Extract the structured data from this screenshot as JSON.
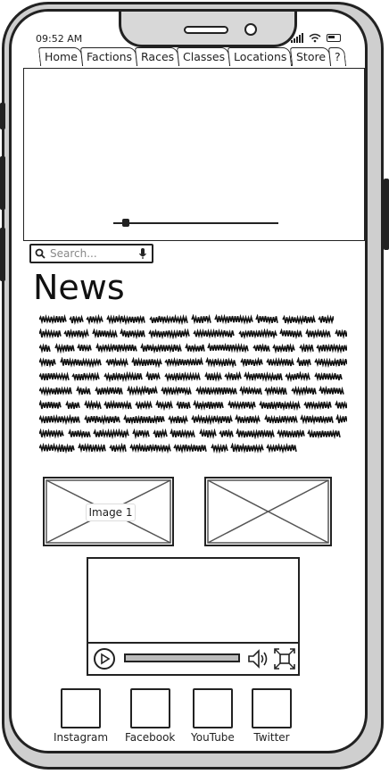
{
  "status_bar": {
    "time": "09:52 AM"
  },
  "tabs": [
    {
      "label": "Home"
    },
    {
      "label": "Factions"
    },
    {
      "label": "Races"
    },
    {
      "label": "Classes"
    },
    {
      "label": "Locations"
    },
    {
      "label": "Store"
    },
    {
      "label": "?"
    }
  ],
  "hero": {
    "slider_value": 0.08
  },
  "search": {
    "placeholder": "Search..."
  },
  "news": {
    "title": "News"
  },
  "images": [
    {
      "label": "Image 1"
    },
    {
      "label": ""
    }
  ],
  "video": {
    "progress": 1.0
  },
  "social": [
    {
      "label": "Instagram"
    },
    {
      "label": "Facebook"
    },
    {
      "label": "YouTube"
    },
    {
      "label": "Twitter"
    }
  ],
  "icons": [
    "search-icon",
    "mic-icon",
    "play-icon",
    "volume-icon",
    "fullscreen-icon",
    "signal-icon",
    "wifi-icon",
    "battery-icon"
  ]
}
